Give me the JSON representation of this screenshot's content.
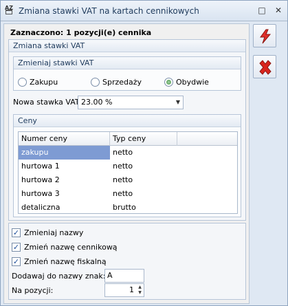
{
  "window": {
    "title": "Zmiana stawki VAT na kartach cennikowych",
    "app_icon": "AZ",
    "buttons": {
      "minimize": "□",
      "close": "✕"
    }
  },
  "selection_label": "Zaznaczono: 1 pozycji(e) cennika",
  "vat_group": {
    "header": "Zmiana stawki VAT",
    "change_group": {
      "header": "Zmieniaj stawki VAT",
      "options": [
        "Zakupu",
        "Sprzedaży",
        "Obydwie"
      ],
      "selected": "Obydwie"
    },
    "new_rate_label": "Nowa stawka VAT:",
    "new_rate_value": "23.00 %",
    "prices_group": {
      "header": "Ceny",
      "columns": [
        "Numer ceny",
        "Typ ceny"
      ],
      "rows": [
        {
          "numer": "zakupu",
          "typ": "netto",
          "selected": true
        },
        {
          "numer": "hurtowa 1",
          "typ": "netto"
        },
        {
          "numer": "hurtowa 2",
          "typ": "netto"
        },
        {
          "numer": "hurtowa 3",
          "typ": "netto"
        },
        {
          "numer": "detaliczna",
          "typ": "brutto"
        }
      ]
    }
  },
  "names_group": {
    "change_names_label": "Zmieniaj nazwy",
    "change_names_checked": true,
    "change_price_name_label": "Zmień nazwę cennikową",
    "change_price_name_checked": true,
    "change_fiscal_name_label": "Zmień nazwę fiskalną",
    "change_fiscal_name_checked": true,
    "add_to_name_label": "Dodawaj do nazwy znak:",
    "add_to_name_value": "A",
    "position_label": "Na pozycji:",
    "position_value": "1"
  },
  "side_buttons": {
    "execute_icon": "lightning-icon",
    "cancel_icon": "red-x-icon"
  },
  "colors": {
    "selected_row": "#7e9bd3",
    "execute": "#e0302a",
    "cancel": "#d9251d"
  }
}
